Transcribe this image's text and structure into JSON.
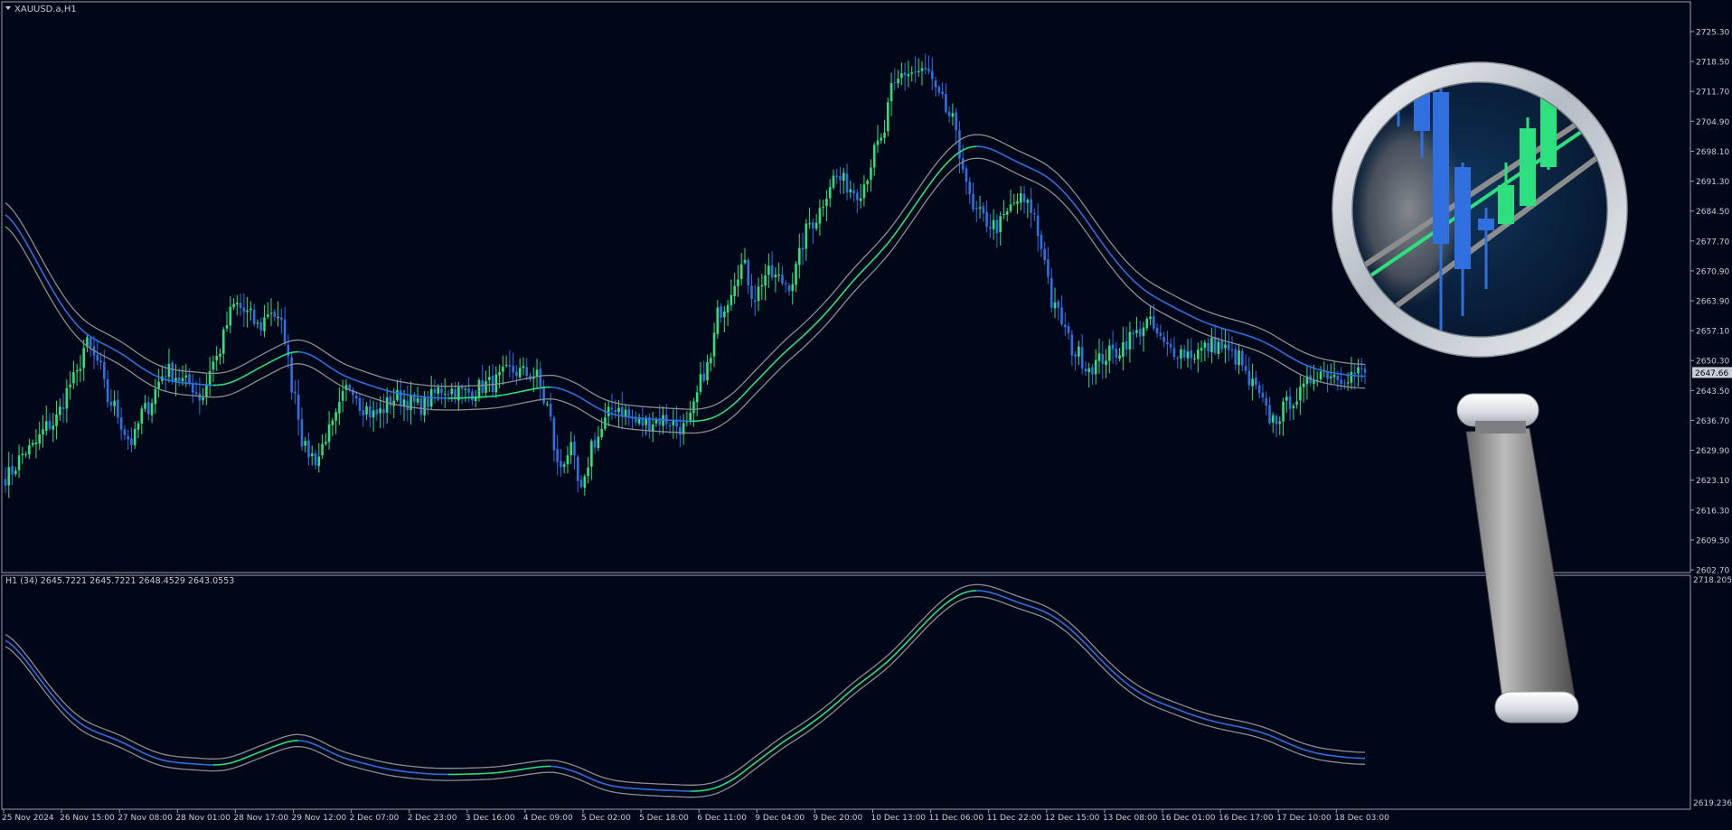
{
  "window": {
    "title": "XAUUSD.a,H1",
    "indicator_title": "H1  (34) 2645.7221 2645.7221 2648.4529 2643.0553"
  },
  "colors": {
    "background": "#000719",
    "grid": "#9aa0a8",
    "bull": "#2ee07d",
    "bear": "#2f6fe0",
    "band_outer": "#8d8d8d",
    "mid_line_up": "#2ee07d",
    "mid_line_down": "#2f6fe0",
    "price_tag_bg": "#c8ccd4"
  },
  "chart_data": [
    {
      "type": "candlestick",
      "symbol": "XAUUSD.a",
      "timeframe": "H1",
      "y_tick_labels": [
        "2725.30",
        "2718.50",
        "2711.70",
        "2704.90",
        "2698.10",
        "2691.30",
        "2684.50",
        "2677.70",
        "2670.90",
        "2663.90",
        "2657.10",
        "2650.30",
        "2643.50",
        "2636.70",
        "2629.90",
        "2623.10",
        "2616.30",
        "2609.50",
        "2602.70"
      ],
      "current_price": "2647.66",
      "x_tick_labels": [
        "25 Nov 2024",
        "26 Nov 15:00",
        "27 Nov 08:00",
        "28 Nov 01:00",
        "28 Nov 17:00",
        "29 Nov 12:00",
        "2 Dec 07:00",
        "2 Dec 23:00",
        "3 Dec 16:00",
        "4 Dec 09:00",
        "5 Dec 02:00",
        "5 Dec 18:00",
        "6 Dec 11:00",
        "9 Dec 04:00",
        "9 Dec 20:00",
        "10 Dec 13:00",
        "11 Dec 06:00",
        "11 Dec 22:00",
        "12 Dec 15:00",
        "13 Dec 08:00",
        "16 Dec 01:00",
        "16 Dec 17:00",
        "17 Dec 10:00",
        "18 Dec 03:00"
      ],
      "ylim": [
        2602.7,
        2725.3
      ],
      "price_path": [
        [
          0,
          2624
        ],
        [
          2,
          2630
        ],
        [
          4,
          2636
        ],
        [
          6,
          2646
        ],
        [
          7,
          2654
        ],
        [
          8,
          2650
        ],
        [
          9,
          2641
        ],
        [
          11,
          2632
        ],
        [
          12,
          2639
        ],
        [
          14,
          2648
        ],
        [
          16,
          2645
        ],
        [
          17,
          2642
        ],
        [
          18,
          2650
        ],
        [
          20,
          2663
        ],
        [
          21,
          2661
        ],
        [
          22,
          2658
        ],
        [
          23,
          2662
        ],
        [
          24,
          2658
        ],
        [
          25,
          2644
        ],
        [
          26,
          2630
        ],
        [
          27,
          2628
        ],
        [
          28,
          2634
        ],
        [
          30,
          2645
        ],
        [
          31,
          2640
        ],
        [
          32,
          2638
        ],
        [
          34,
          2642
        ],
        [
          36,
          2640
        ],
        [
          38,
          2644
        ],
        [
          40,
          2643
        ],
        [
          42,
          2645
        ],
        [
          44,
          2648
        ],
        [
          46,
          2647
        ],
        [
          47,
          2640
        ],
        [
          48,
          2626
        ],
        [
          49,
          2630
        ],
        [
          50,
          2620
        ],
        [
          51,
          2632
        ],
        [
          53,
          2640
        ],
        [
          55,
          2636
        ],
        [
          57,
          2637
        ],
        [
          59,
          2635
        ],
        [
          61,
          2649
        ],
        [
          62,
          2662
        ],
        [
          64,
          2672
        ],
        [
          65,
          2665
        ],
        [
          66,
          2670
        ],
        [
          68,
          2668
        ],
        [
          70,
          2682
        ],
        [
          72,
          2692
        ],
        [
          74,
          2689
        ],
        [
          76,
          2700
        ],
        [
          77,
          2712
        ],
        [
          78,
          2716
        ],
        [
          80,
          2716
        ],
        [
          81,
          2710
        ],
        [
          82,
          2706
        ],
        [
          83,
          2696
        ],
        [
          84,
          2684
        ],
        [
          86,
          2681
        ],
        [
          88,
          2687
        ],
        [
          89,
          2685
        ],
        [
          90,
          2676
        ],
        [
          91,
          2662
        ],
        [
          93,
          2652
        ],
        [
          94,
          2649
        ],
        [
          96,
          2652
        ],
        [
          98,
          2656
        ],
        [
          99,
          2659
        ],
        [
          101,
          2653
        ],
        [
          103,
          2652
        ],
        [
          105,
          2654
        ],
        [
          107,
          2651
        ],
        [
          108,
          2645
        ],
        [
          110,
          2637
        ],
        [
          112,
          2642
        ],
        [
          114,
          2648
        ],
        [
          116,
          2647
        ],
        [
          118,
          2647.66
        ]
      ],
      "band_period": 34
    },
    {
      "type": "line",
      "indicator": "H1 (34)",
      "values_label": [
        "2645.7221",
        "2645.7221",
        "2648.4529",
        "2643.0553"
      ],
      "y_tick_labels": [
        "2718.2053",
        "2619.236"
      ],
      "ylim": [
        2619.236,
        2718.2053
      ],
      "series": [
        {
          "values": []
        },
        {
          "values": []
        },
        {
          "values": []
        }
      ]
    }
  ],
  "magnifier": {
    "icon": "magnifying-glass-icon"
  }
}
